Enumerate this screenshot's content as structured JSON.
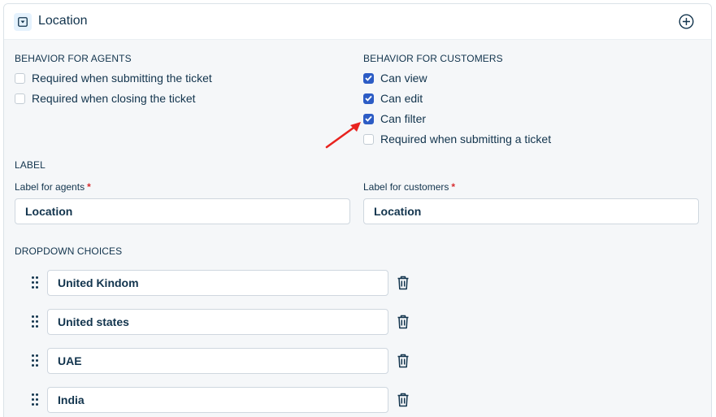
{
  "header": {
    "title": "Location",
    "type_icon": "dropdown-icon",
    "add_icon": "plus-circle-icon"
  },
  "agents": {
    "title": "BEHAVIOR FOR AGENTS",
    "options": [
      {
        "label": "Required when submitting the ticket",
        "checked": false
      },
      {
        "label": "Required when closing the ticket",
        "checked": false
      }
    ]
  },
  "customers": {
    "title": "BEHAVIOR FOR CUSTOMERS",
    "options": [
      {
        "label": "Can view",
        "checked": true
      },
      {
        "label": "Can edit",
        "checked": true
      },
      {
        "label": "Can filter",
        "checked": true
      },
      {
        "label": "Required when submitting a ticket",
        "checked": false
      }
    ]
  },
  "label_section": {
    "title": "LABEL",
    "agents_label": "Label for agents",
    "agents_value": "Location",
    "customers_label": "Label for customers",
    "customers_value": "Location",
    "required_mark": "*"
  },
  "dropdown": {
    "title": "DROPDOWN CHOICES",
    "choices": [
      "United Kindom",
      "United states",
      "UAE",
      "India"
    ],
    "delete_icon": "trash-icon",
    "drag_icon": "drag-handle-icon"
  },
  "colors": {
    "accent": "#2c5cc5",
    "required": "#d72d30",
    "annotation": "#e8231f"
  }
}
